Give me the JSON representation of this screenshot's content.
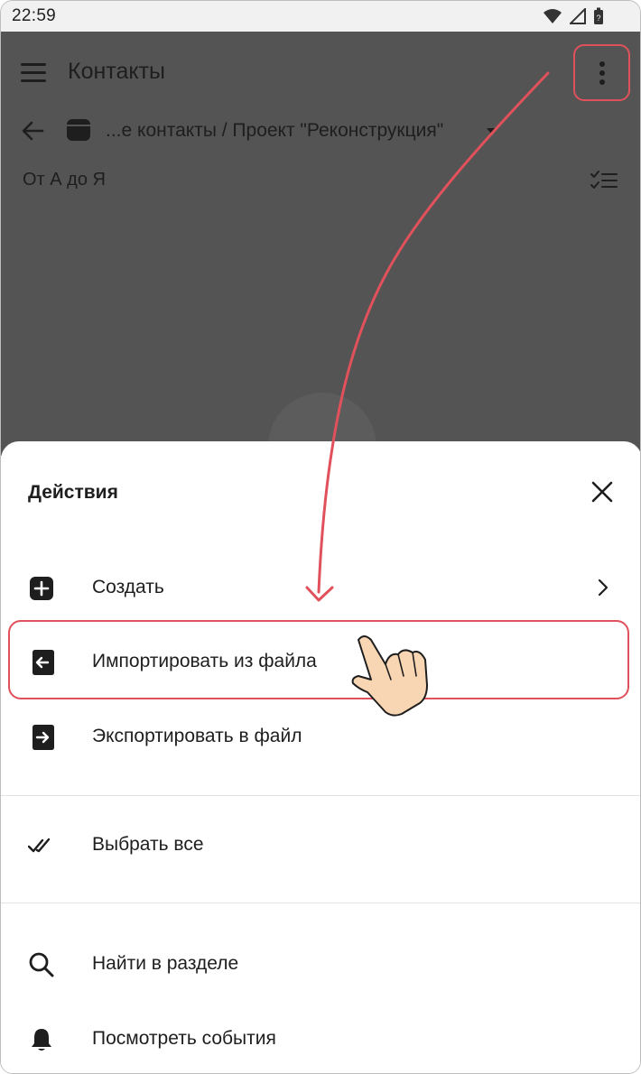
{
  "status": {
    "time": "22:59"
  },
  "app": {
    "title": "Контакты",
    "breadcrumb": "...е контакты / Проект \"Реконструкция\"",
    "sort_label": "От А до Я"
  },
  "sheet": {
    "title": "Действия",
    "items": [
      {
        "label": "Создать",
        "icon": "plus-square-icon"
      },
      {
        "label": "Импортировать из файла",
        "icon": "import-icon"
      },
      {
        "label": "Экспортировать в файл",
        "icon": "export-icon"
      },
      {
        "label": "Выбрать все",
        "icon": "double-check-icon"
      },
      {
        "label": "Найти в разделе",
        "icon": "search-icon"
      },
      {
        "label": "Посмотреть события",
        "icon": "bell-icon"
      }
    ]
  },
  "colors": {
    "highlight": "#e0515b",
    "dim_overlay": "#545454",
    "text": "#1e1e1e"
  }
}
